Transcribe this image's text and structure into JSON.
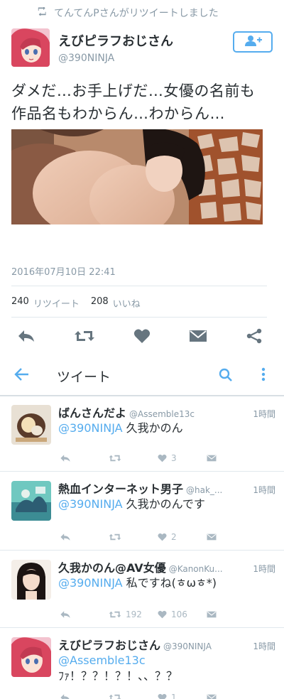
{
  "retweet_notice": "てんてんPさんがリツイートしました",
  "tweet": {
    "author_name": "えびピラフおじさん",
    "author_handle": "@390NINJA",
    "text": "ダメだ…お手上げだ…女優の名前も作品名もわからん…わからん…",
    "timestamp": "2016年07月10日 22:41",
    "retweet_count": "240",
    "retweet_label": "リツイート",
    "like_count": "208",
    "like_label": "いいね"
  },
  "appbar": {
    "title": "ツイート"
  },
  "replies": [
    {
      "name": "ばんさんだよ",
      "handle": "@Assemble13c",
      "time": "1時間",
      "mention": "@390NINJA",
      "text": " 久我かのん",
      "retweets": "",
      "likes": "3"
    },
    {
      "name": "熱血インターネット男子",
      "handle": "@hak_...",
      "time": "1時間",
      "mention": "@390NINJA",
      "text": " 久我かのんです",
      "retweets": "",
      "likes": "2"
    },
    {
      "name": "久我かのん@AV女優",
      "handle": "@KanonKu...",
      "time": "1時間",
      "mention": "@390NINJA",
      "text": " 私ですね(ㅎωㅎ*)",
      "retweets": "192",
      "likes": "106"
    },
    {
      "name": "えびピラフおじさん",
      "handle": "@390NINJA",
      "time": "1時間",
      "mention": "@Assemble13c",
      "text": "ﾌｧ！？？！？！、、？？",
      "retweets": "",
      "likes": "1"
    }
  ],
  "colors": {
    "accent": "#55acee",
    "muted": "#8899a6",
    "action_icon": "#aab8c2",
    "dark_icon": "#66757f"
  }
}
